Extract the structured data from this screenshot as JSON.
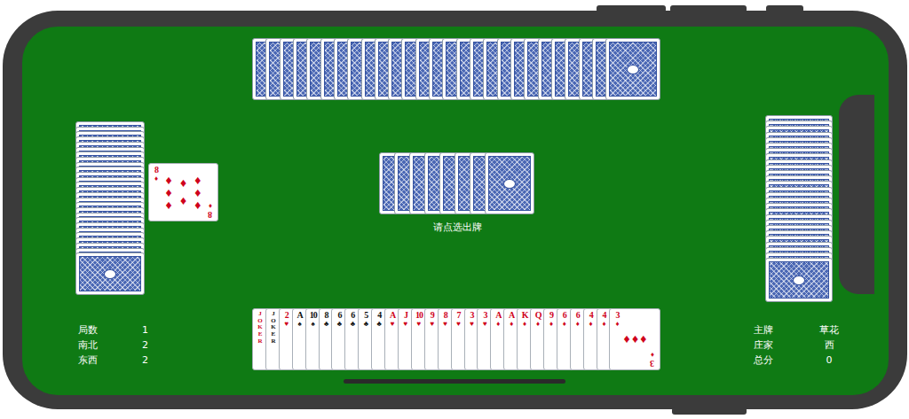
{
  "table": {
    "prompt": "请点选出牌"
  },
  "north_hand": {
    "count": 27
  },
  "west_hand": {
    "count": 27
  },
  "east_hand": {
    "count": 27
  },
  "kitty": {
    "count": 8
  },
  "played_card": {
    "rank": "8",
    "suit": "♦",
    "color": "#d0021b"
  },
  "hand": {
    "cards": [
      {
        "rank": "JOKER",
        "color": "#d0021b"
      },
      {
        "rank": "JOKER",
        "color": "#111111"
      },
      {
        "rank": "2",
        "suit": "♥",
        "color": "#d0021b"
      },
      {
        "rank": "A",
        "suit": "♠",
        "color": "#111111"
      },
      {
        "rank": "10",
        "suit": "♠",
        "color": "#111111"
      },
      {
        "rank": "8",
        "suit": "♣",
        "color": "#111111"
      },
      {
        "rank": "6",
        "suit": "♣",
        "color": "#111111"
      },
      {
        "rank": "6",
        "suit": "♣",
        "color": "#111111"
      },
      {
        "rank": "5",
        "suit": "♣",
        "color": "#111111"
      },
      {
        "rank": "4",
        "suit": "♣",
        "color": "#111111"
      },
      {
        "rank": "A",
        "suit": "♥",
        "color": "#d0021b"
      },
      {
        "rank": "J",
        "suit": "♥",
        "color": "#d0021b"
      },
      {
        "rank": "10",
        "suit": "♥",
        "color": "#d0021b"
      },
      {
        "rank": "9",
        "suit": "♥",
        "color": "#d0021b"
      },
      {
        "rank": "8",
        "suit": "♥",
        "color": "#d0021b"
      },
      {
        "rank": "7",
        "suit": "♥",
        "color": "#d0021b"
      },
      {
        "rank": "3",
        "suit": "♥",
        "color": "#d0021b"
      },
      {
        "rank": "3",
        "suit": "♥",
        "color": "#d0021b"
      },
      {
        "rank": "A",
        "suit": "♦",
        "color": "#d0021b"
      },
      {
        "rank": "A",
        "suit": "♦",
        "color": "#d0021b"
      },
      {
        "rank": "K",
        "suit": "♦",
        "color": "#d0021b"
      },
      {
        "rank": "Q",
        "suit": "♦",
        "color": "#d0021b"
      },
      {
        "rank": "9",
        "suit": "♦",
        "color": "#d0021b"
      },
      {
        "rank": "6",
        "suit": "♦",
        "color": "#d0021b"
      },
      {
        "rank": "6",
        "suit": "♦",
        "color": "#d0021b"
      },
      {
        "rank": "4",
        "suit": "♦",
        "color": "#d0021b"
      },
      {
        "rank": "4",
        "suit": "♦",
        "color": "#d0021b"
      },
      {
        "rank": "3",
        "suit": "♦",
        "color": "#d0021b"
      }
    ]
  },
  "score_panel": {
    "rows": [
      {
        "label": "局数",
        "value": "1"
      },
      {
        "label": "南北",
        "value": "2"
      },
      {
        "label": "东西",
        "value": "2"
      }
    ]
  },
  "info_panel": {
    "rows": [
      {
        "label": "主牌",
        "value": "草花"
      },
      {
        "label": "庄家",
        "value": "西"
      },
      {
        "label": "总分",
        "value": "0"
      }
    ]
  }
}
